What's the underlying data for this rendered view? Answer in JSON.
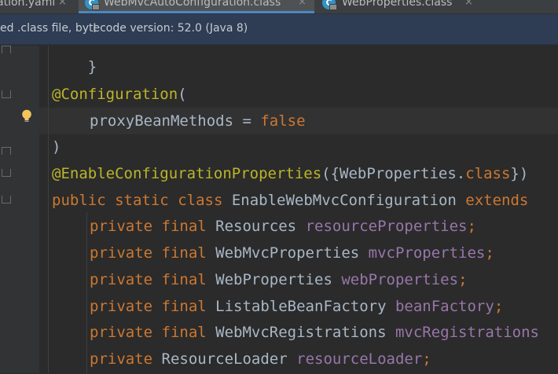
{
  "tabs": [
    {
      "label": "ation.yaml",
      "active": false
    },
    {
      "label": "WebMvcAutoConfiguration.class",
      "active": true
    },
    {
      "label": "WebProperties.class",
      "active": false
    }
  ],
  "tab_close_glyph": "×",
  "tab_icon_letter": "C",
  "banner": {
    "text": "ed .class file, bytecode version: 52.0 (Java 8)"
  },
  "code": {
    "brace_fragment": "}",
    "l1": {
      "ann": "@Configuration",
      "paren": "("
    },
    "l2": {
      "name": "proxyBeanMethods",
      "eq": " = ",
      "value": "false"
    },
    "l3": {
      "paren": ")"
    },
    "l4": {
      "ann": "@EnableConfigurationProperties",
      "open": "({WebProperties.",
      "kw": "class",
      "close": "})"
    },
    "l5": {
      "kw1": "public",
      "kw2": "static",
      "kw3": "class",
      "name": "EnableWebMvcConfiguration",
      "kw4": "extends"
    },
    "fields": [
      {
        "mods": "private final",
        "type": "Resources",
        "name": "resourceProperties",
        "semi": ";"
      },
      {
        "mods": "private final",
        "type": "WebMvcProperties",
        "name": "mvcProperties",
        "semi": ";"
      },
      {
        "mods": "private final",
        "type": "WebProperties",
        "name": "webProperties",
        "semi": ";"
      },
      {
        "mods": "private final",
        "type": "ListableBeanFactory",
        "name": "beanFactory",
        "semi": ";"
      },
      {
        "mods": "private final",
        "type": "WebMvcRegistrations",
        "name": "mvcRegistrations",
        "semi": ""
      },
      {
        "mods": "private",
        "type": "ResourceLoader",
        "name": "resourceLoader",
        "semi": ";"
      }
    ]
  },
  "colors": {
    "editor_bg": "#2b2b2b",
    "annotation": "#bbb529",
    "keyword": "#cc7832",
    "field": "#9876aa",
    "text": "#a9b7c6",
    "banner_bg": "#2e3d53",
    "tab_active_underline": "#4a88c7"
  }
}
